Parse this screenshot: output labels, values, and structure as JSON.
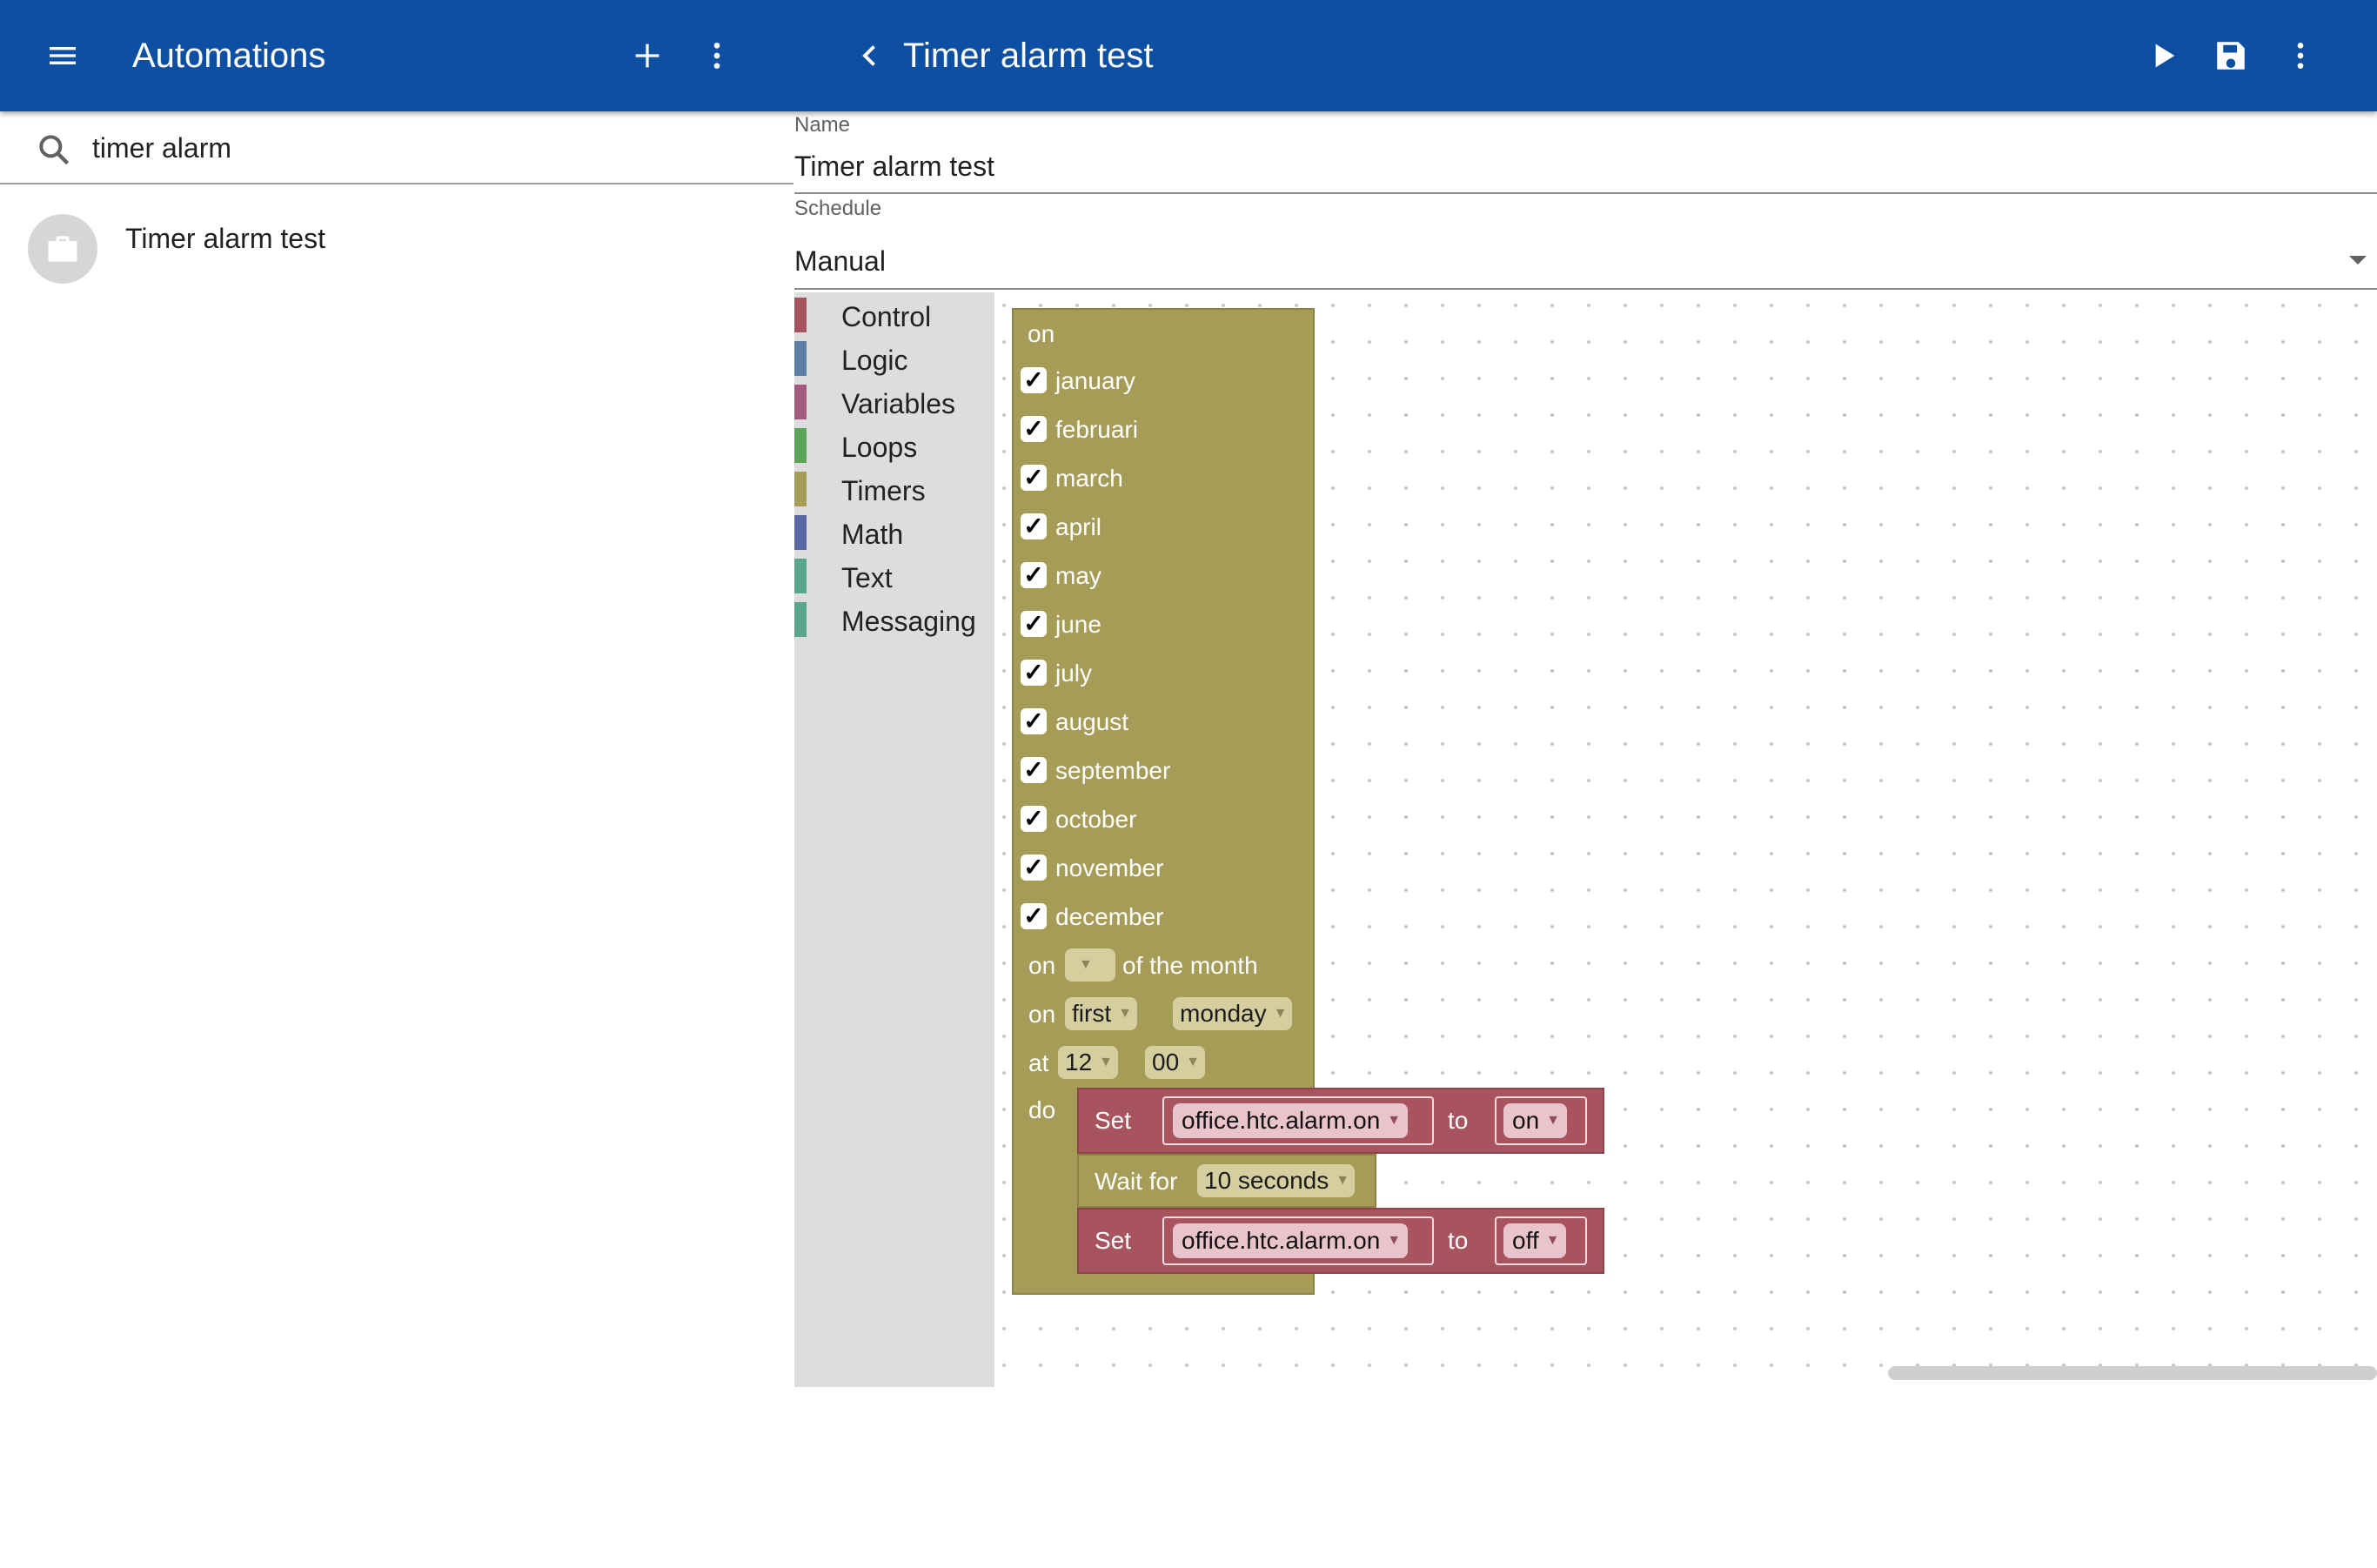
{
  "colors": {
    "appbar": "#0d4fa3",
    "timer_block": "#a59c58",
    "set_block": "#a8545e",
    "toolbox_bg": "#dddddd"
  },
  "header": {
    "menu_icon": "menu-icon",
    "title": "Automations",
    "add_icon": "plus-icon",
    "more_icon": "more-vert-icon",
    "back_icon": "chevron-left-icon",
    "editor_title": "Timer alarm test",
    "run_icon": "play-icon",
    "save_icon": "save-icon",
    "editor_more_icon": "more-vert-icon"
  },
  "search": {
    "icon": "search-icon",
    "value": "timer alarm"
  },
  "automations_list": [
    {
      "name": "Timer alarm test",
      "icon": "briefcase-icon"
    }
  ],
  "form": {
    "name_label": "Name",
    "name_value": "Timer alarm test",
    "schedule_label": "Schedule",
    "schedule_value": "Manual"
  },
  "toolbox": [
    {
      "label": "Control",
      "color": "#a6545e"
    },
    {
      "label": "Logic",
      "color": "#5b80a5"
    },
    {
      "label": "Variables",
      "color": "#a55b80"
    },
    {
      "label": "Loops",
      "color": "#5ba55b"
    },
    {
      "label": "Timers",
      "color": "#a59c58"
    },
    {
      "label": "Math",
      "color": "#5b67a5"
    },
    {
      "label": "Text",
      "color": "#5ba58c"
    },
    {
      "label": "Messaging",
      "color": "#5ba58c"
    }
  ],
  "timer_block": {
    "on_label": "on",
    "months": [
      {
        "name": "january",
        "checked": true
      },
      {
        "name": "februari",
        "checked": true
      },
      {
        "name": "march",
        "checked": true
      },
      {
        "name": "april",
        "checked": true
      },
      {
        "name": "may",
        "checked": true
      },
      {
        "name": "june",
        "checked": true
      },
      {
        "name": "july",
        "checked": true
      },
      {
        "name": "august",
        "checked": true
      },
      {
        "name": "september",
        "checked": true
      },
      {
        "name": "october",
        "checked": true
      },
      {
        "name": "november",
        "checked": true
      },
      {
        "name": "december",
        "checked": true
      }
    ],
    "check_mark": "✓",
    "day_of_month_prefix": "on",
    "day_of_month_value": "",
    "day_of_month_suffix": "of the month",
    "weekday_prefix": "on",
    "weekday_ordinal": "first",
    "weekday_value": "monday",
    "at_label": "at",
    "hour": "12",
    "minute": "00",
    "do_label": "do",
    "statements": [
      {
        "type": "set",
        "label": "Set",
        "variable": "office.htc.alarm.on",
        "to_label": "to",
        "value": "on"
      },
      {
        "type": "wait",
        "label": "Wait for",
        "value": "10 seconds"
      },
      {
        "type": "set",
        "label": "Set",
        "variable": "office.htc.alarm.on",
        "to_label": "to",
        "value": "off"
      }
    ]
  },
  "dropdown_arrow": "▼"
}
